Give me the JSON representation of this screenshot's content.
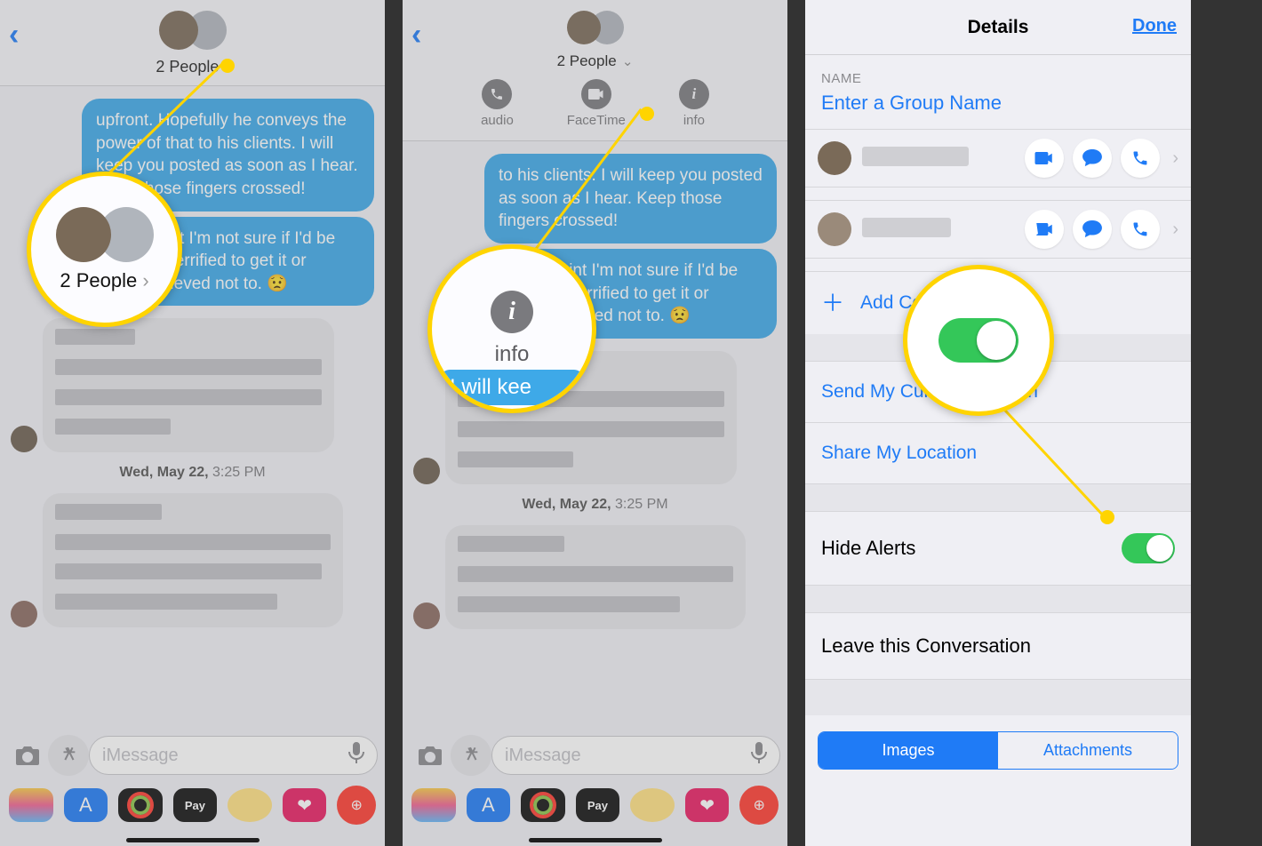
{
  "panel1": {
    "people_label": "2 People",
    "bubble1": "upfront.  Hopefully he conveys the power of that to his clients.  I will keep you posted as soon as I hear.  Keep those fingers crossed!",
    "bubble2": "At this point I'm not sure if I'd be thrilled or terrified to get it or maybe relieved not to. 😟",
    "timestamp_bold": "Wed, May 22,",
    "timestamp_light": " 3:25 PM",
    "compose_placeholder": "iMessage",
    "apple_pay_label": "Pay",
    "callout_people": "2 People"
  },
  "panel2": {
    "people_label": "2 People",
    "action_audio": "audio",
    "action_facetime": "FaceTime",
    "action_info": "info",
    "bubble1a": "to his clients.  I will keep you posted as soon as I hear.  Keep those fingers crossed!",
    "bubble2a": "At this point I'm not sure if I'd be thrilled or terrified to get it or maybe relieved not to. 😟",
    "timestamp_bold": "Wed, May 22,",
    "timestamp_light": " 3:25 PM",
    "compose_placeholder": "iMessage",
    "apple_pay_label": "Pay",
    "callout_info": "info",
    "callout_clip": "I will kee"
  },
  "panel3": {
    "title": "Details",
    "done": "Done",
    "name_label": "NAME",
    "group_name_placeholder": "Enter a Group Name",
    "add_contact": "Add Contact",
    "send_location": "Send My Current Location",
    "share_location": "Share My Location",
    "hide_alerts": "Hide Alerts",
    "leave": "Leave this Conversation",
    "seg_images": "Images",
    "seg_attachments": "Attachments"
  }
}
